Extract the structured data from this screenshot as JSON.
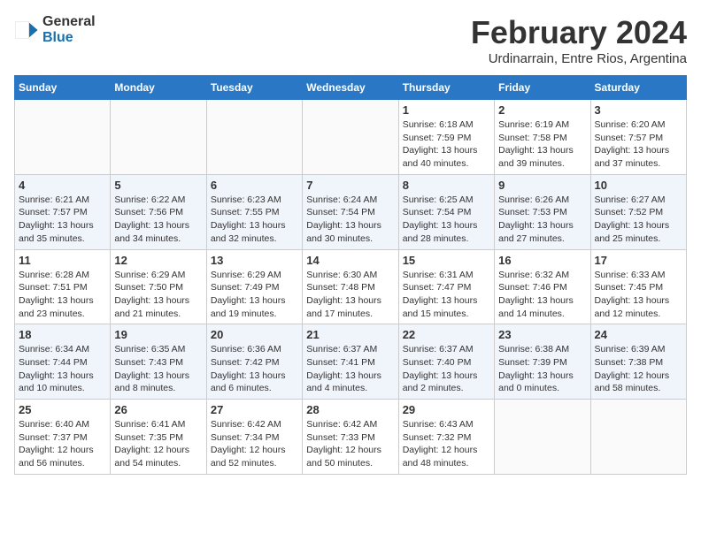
{
  "header": {
    "logo_general": "General",
    "logo_blue": "Blue",
    "month_title": "February 2024",
    "location": "Urdinarrain, Entre Rios, Argentina"
  },
  "weekdays": [
    "Sunday",
    "Monday",
    "Tuesday",
    "Wednesday",
    "Thursday",
    "Friday",
    "Saturday"
  ],
  "weeks": [
    [
      {
        "day": "",
        "info": ""
      },
      {
        "day": "",
        "info": ""
      },
      {
        "day": "",
        "info": ""
      },
      {
        "day": "",
        "info": ""
      },
      {
        "day": "1",
        "info": "Sunrise: 6:18 AM\nSunset: 7:59 PM\nDaylight: 13 hours and 40 minutes."
      },
      {
        "day": "2",
        "info": "Sunrise: 6:19 AM\nSunset: 7:58 PM\nDaylight: 13 hours and 39 minutes."
      },
      {
        "day": "3",
        "info": "Sunrise: 6:20 AM\nSunset: 7:57 PM\nDaylight: 13 hours and 37 minutes."
      }
    ],
    [
      {
        "day": "4",
        "info": "Sunrise: 6:21 AM\nSunset: 7:57 PM\nDaylight: 13 hours and 35 minutes."
      },
      {
        "day": "5",
        "info": "Sunrise: 6:22 AM\nSunset: 7:56 PM\nDaylight: 13 hours and 34 minutes."
      },
      {
        "day": "6",
        "info": "Sunrise: 6:23 AM\nSunset: 7:55 PM\nDaylight: 13 hours and 32 minutes."
      },
      {
        "day": "7",
        "info": "Sunrise: 6:24 AM\nSunset: 7:54 PM\nDaylight: 13 hours and 30 minutes."
      },
      {
        "day": "8",
        "info": "Sunrise: 6:25 AM\nSunset: 7:54 PM\nDaylight: 13 hours and 28 minutes."
      },
      {
        "day": "9",
        "info": "Sunrise: 6:26 AM\nSunset: 7:53 PM\nDaylight: 13 hours and 27 minutes."
      },
      {
        "day": "10",
        "info": "Sunrise: 6:27 AM\nSunset: 7:52 PM\nDaylight: 13 hours and 25 minutes."
      }
    ],
    [
      {
        "day": "11",
        "info": "Sunrise: 6:28 AM\nSunset: 7:51 PM\nDaylight: 13 hours and 23 minutes."
      },
      {
        "day": "12",
        "info": "Sunrise: 6:29 AM\nSunset: 7:50 PM\nDaylight: 13 hours and 21 minutes."
      },
      {
        "day": "13",
        "info": "Sunrise: 6:29 AM\nSunset: 7:49 PM\nDaylight: 13 hours and 19 minutes."
      },
      {
        "day": "14",
        "info": "Sunrise: 6:30 AM\nSunset: 7:48 PM\nDaylight: 13 hours and 17 minutes."
      },
      {
        "day": "15",
        "info": "Sunrise: 6:31 AM\nSunset: 7:47 PM\nDaylight: 13 hours and 15 minutes."
      },
      {
        "day": "16",
        "info": "Sunrise: 6:32 AM\nSunset: 7:46 PM\nDaylight: 13 hours and 14 minutes."
      },
      {
        "day": "17",
        "info": "Sunrise: 6:33 AM\nSunset: 7:45 PM\nDaylight: 13 hours and 12 minutes."
      }
    ],
    [
      {
        "day": "18",
        "info": "Sunrise: 6:34 AM\nSunset: 7:44 PM\nDaylight: 13 hours and 10 minutes."
      },
      {
        "day": "19",
        "info": "Sunrise: 6:35 AM\nSunset: 7:43 PM\nDaylight: 13 hours and 8 minutes."
      },
      {
        "day": "20",
        "info": "Sunrise: 6:36 AM\nSunset: 7:42 PM\nDaylight: 13 hours and 6 minutes."
      },
      {
        "day": "21",
        "info": "Sunrise: 6:37 AM\nSunset: 7:41 PM\nDaylight: 13 hours and 4 minutes."
      },
      {
        "day": "22",
        "info": "Sunrise: 6:37 AM\nSunset: 7:40 PM\nDaylight: 13 hours and 2 minutes."
      },
      {
        "day": "23",
        "info": "Sunrise: 6:38 AM\nSunset: 7:39 PM\nDaylight: 13 hours and 0 minutes."
      },
      {
        "day": "24",
        "info": "Sunrise: 6:39 AM\nSunset: 7:38 PM\nDaylight: 12 hours and 58 minutes."
      }
    ],
    [
      {
        "day": "25",
        "info": "Sunrise: 6:40 AM\nSunset: 7:37 PM\nDaylight: 12 hours and 56 minutes."
      },
      {
        "day": "26",
        "info": "Sunrise: 6:41 AM\nSunset: 7:35 PM\nDaylight: 12 hours and 54 minutes."
      },
      {
        "day": "27",
        "info": "Sunrise: 6:42 AM\nSunset: 7:34 PM\nDaylight: 12 hours and 52 minutes."
      },
      {
        "day": "28",
        "info": "Sunrise: 6:42 AM\nSunset: 7:33 PM\nDaylight: 12 hours and 50 minutes."
      },
      {
        "day": "29",
        "info": "Sunrise: 6:43 AM\nSunset: 7:32 PM\nDaylight: 12 hours and 48 minutes."
      },
      {
        "day": "",
        "info": ""
      },
      {
        "day": "",
        "info": ""
      }
    ]
  ]
}
